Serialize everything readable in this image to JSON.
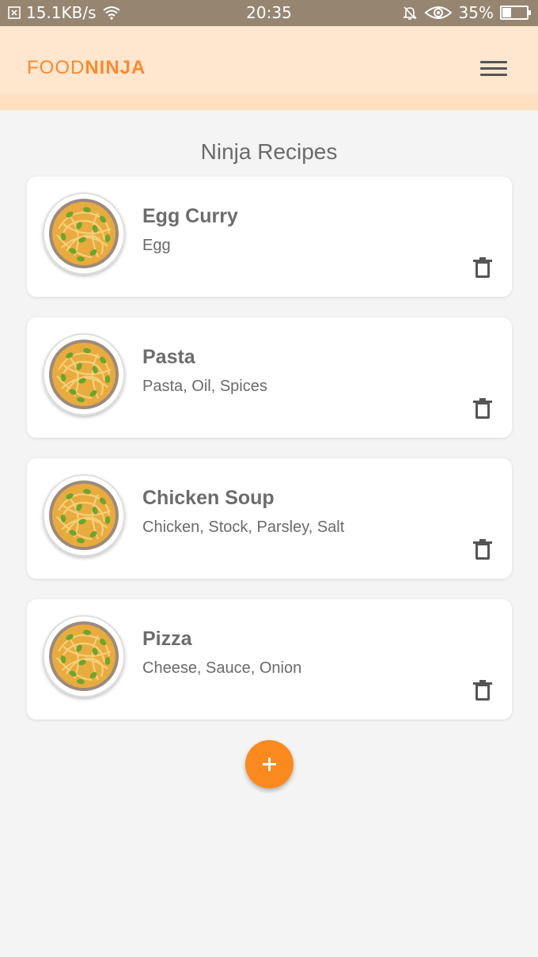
{
  "status_bar": {
    "network_speed": "15.1KB/s",
    "time": "20:35",
    "battery_percent": "35%",
    "battery_level": 0.35
  },
  "header": {
    "brand_part1": "FOOD",
    "brand_part2": "NINJA",
    "accent_color": "#fb8a2b",
    "menu_icon": "hamburger-menu-icon"
  },
  "page_title": "Ninja Recipes",
  "recipes": [
    {
      "title": "Egg Curry",
      "ingredients": "Egg",
      "image_icon": "noodle-bowl-icon",
      "action_icon": "trash-icon"
    },
    {
      "title": "Pasta",
      "ingredients": "Pasta, Oil, Spices",
      "image_icon": "noodle-bowl-icon",
      "action_icon": "trash-icon"
    },
    {
      "title": "Chicken Soup",
      "ingredients": "Chicken, Stock, Parsley, Salt",
      "image_icon": "noodle-bowl-icon",
      "action_icon": "trash-icon"
    },
    {
      "title": "Pizza",
      "ingredients": "Cheese, Sauce, Onion",
      "image_icon": "noodle-bowl-icon",
      "action_icon": "trash-icon"
    }
  ],
  "fab": {
    "icon": "plus-icon",
    "color": "#fb8a1e"
  }
}
